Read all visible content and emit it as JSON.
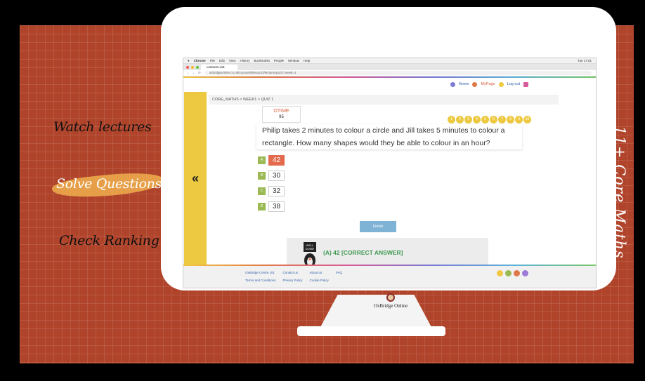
{
  "sidebar": {
    "items": [
      {
        "label": "Watch lectures"
      },
      {
        "label": "Solve Questions"
      },
      {
        "label": "Check Ranking"
      }
    ]
  },
  "vertical_title": "11+ Core Maths",
  "browser": {
    "menu": [
      "Chrome",
      "File",
      "Edit",
      "View",
      "History",
      "Bookmarks",
      "People",
      "Window",
      "Help"
    ],
    "tab_label": "Lectures List",
    "url": "oxbridgeonline.co.uk/course/5/lesson/3/lecture/quiz/1?week=1",
    "clock": "Tue 17:01"
  },
  "nav": {
    "home": "Home",
    "mypage": "MyPage",
    "logout": "Log out"
  },
  "breadcrumb": "CORE_MATHS > WEEK1 > QUIZ 1",
  "timer": {
    "label": "OTIME",
    "value": "95"
  },
  "question_numbers": [
    "1",
    "2",
    "3",
    "4",
    "5",
    "6",
    "7",
    "8",
    "9",
    "10"
  ],
  "question": {
    "line1": "Philip takes 2 minutes to colour a circle and Jill takes 5 minutes to colour a",
    "line2": "rectangle. How many shapes would they be able to colour in an hour?"
  },
  "options": [
    {
      "letter": "A",
      "value": "42",
      "selected": true
    },
    {
      "letter": "B",
      "value": "30",
      "selected": false
    },
    {
      "letter": "C",
      "value": "32",
      "selected": false
    },
    {
      "letter": "D",
      "value": "38",
      "selected": false
    }
  ],
  "finish_label": "Finish",
  "answer_text": "(A) 42 [CORRECT ANSWER]",
  "owl_label": "WELL DONE!",
  "footer": {
    "links": [
      "OxBridge Centre Ltd.",
      "Contact us",
      "About us",
      "FAQ",
      "Terms and Conditions",
      "Privacy Policy",
      "Cookie Policy"
    ]
  },
  "back_icon_glyph": "«",
  "brand": "OxBridge Online",
  "colors": {
    "background": "#b0442b",
    "accent_yellow": "#ecc940",
    "selected_option": "#e36a4d",
    "correct_green": "#3f9a52"
  }
}
